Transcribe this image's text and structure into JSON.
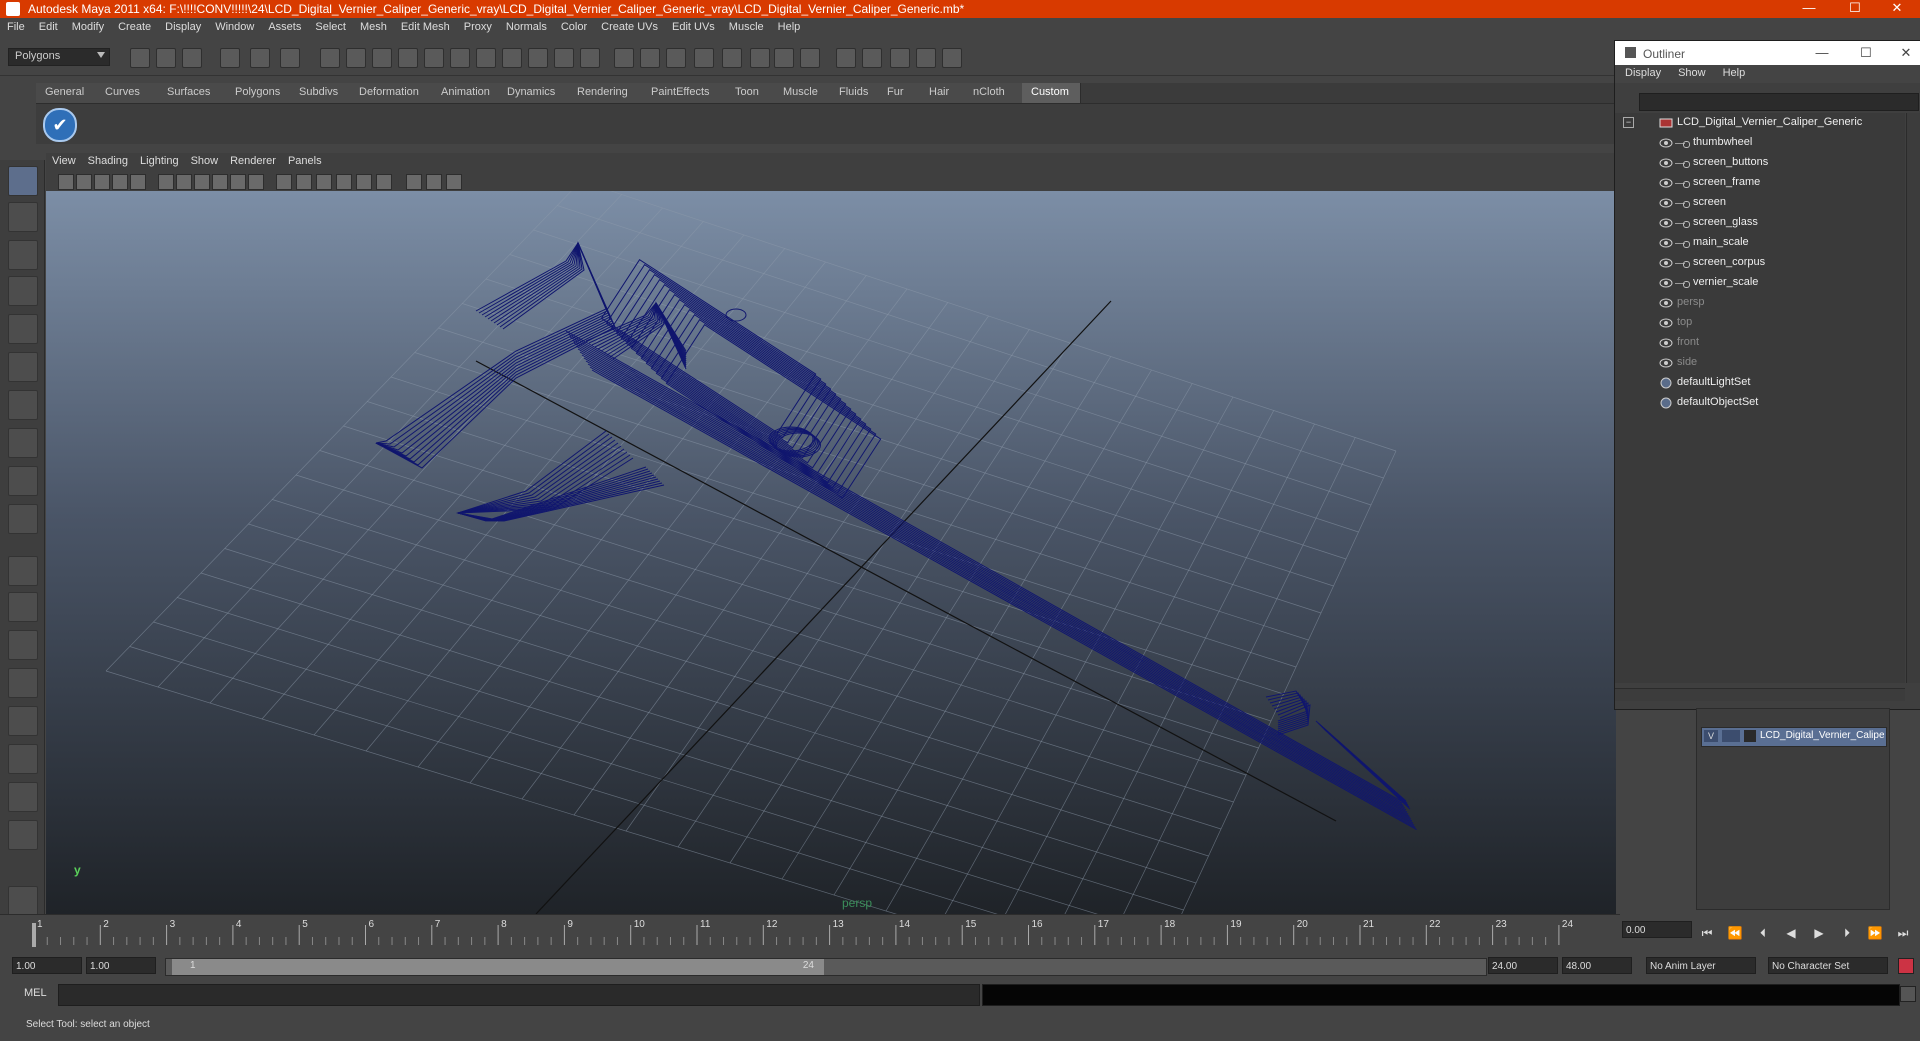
{
  "window": {
    "title": "Autodesk Maya 2011 x64: F:\\!!!!CONV!!!!!\\24\\LCD_Digital_Vernier_Caliper_Generic_vray\\LCD_Digital_Vernier_Caliper_Generic_vray\\LCD_Digital_Vernier_Caliper_Generic.mb*",
    "minimize": "—",
    "maximize": "☐",
    "close": "✕"
  },
  "menubar": [
    "File",
    "Edit",
    "Modify",
    "Create",
    "Display",
    "Window",
    "Assets",
    "Select",
    "Mesh",
    "Edit Mesh",
    "Proxy",
    "Normals",
    "Color",
    "Create UVs",
    "Edit UVs",
    "Muscle",
    "Help"
  ],
  "mode_selector": "Polygons",
  "shelf_tabs": [
    "General",
    "Curves",
    "Surfaces",
    "Polygons",
    "Subdivs",
    "Deformation",
    "Animation",
    "Dynamics",
    "Rendering",
    "PaintEffects",
    "Toon",
    "Muscle",
    "Fluids",
    "Fur",
    "Hair",
    "nCloth",
    "Custom"
  ],
  "active_shelf_tab": "Custom",
  "panel_menu": [
    "View",
    "Shading",
    "Lighting",
    "Show",
    "Renderer",
    "Panels"
  ],
  "viewport": {
    "camera_label": "persp",
    "axis_label": "y",
    "wire_color": "#10166e"
  },
  "outliner": {
    "title": "Outliner",
    "menu": [
      "Display",
      "Show",
      "Help"
    ],
    "items": [
      {
        "label": "LCD_Digital_Vernier_Caliper_Generic",
        "level": 0,
        "dim": false,
        "icon": "group-icon"
      },
      {
        "label": "thumbwheel",
        "level": 1,
        "dim": false,
        "icon": "mesh-icon"
      },
      {
        "label": "screen_buttons",
        "level": 1,
        "dim": false,
        "icon": "mesh-icon"
      },
      {
        "label": "screen_frame",
        "level": 1,
        "dim": false,
        "icon": "mesh-icon"
      },
      {
        "label": "screen",
        "level": 1,
        "dim": false,
        "icon": "mesh-icon"
      },
      {
        "label": "screen_glass",
        "level": 1,
        "dim": false,
        "icon": "mesh-icon"
      },
      {
        "label": "main_scale",
        "level": 1,
        "dim": false,
        "icon": "mesh-icon"
      },
      {
        "label": "screen_corpus",
        "level": 1,
        "dim": false,
        "icon": "mesh-icon"
      },
      {
        "label": "vernier_scale",
        "level": 1,
        "dim": false,
        "icon": "mesh-icon"
      },
      {
        "label": "persp",
        "level": 0,
        "dim": true,
        "icon": "camera-icon"
      },
      {
        "label": "top",
        "level": 0,
        "dim": true,
        "icon": "camera-icon"
      },
      {
        "label": "front",
        "level": 0,
        "dim": true,
        "icon": "camera-icon"
      },
      {
        "label": "side",
        "level": 0,
        "dim": true,
        "icon": "camera-icon"
      },
      {
        "label": "defaultLightSet",
        "level": 0,
        "dim": false,
        "icon": "set-icon"
      },
      {
        "label": "defaultObjectSet",
        "level": 0,
        "dim": false,
        "icon": "set-icon"
      }
    ]
  },
  "layers": {
    "row_visible": "V",
    "row_name": "LCD_Digital_Vernier_Caliper_Generic"
  },
  "timeline": {
    "ticks": [
      "1",
      "2",
      "3",
      "4",
      "5",
      "6",
      "7",
      "8",
      "9",
      "10",
      "11",
      "12",
      "13",
      "14",
      "15",
      "16",
      "17",
      "18",
      "19",
      "20",
      "21",
      "22",
      "23",
      "24"
    ],
    "current_time": "0.00"
  },
  "playback": [
    "⏮",
    "⏪",
    "⏴",
    "◀",
    "▶",
    "⏵",
    "⏩",
    "⏭"
  ],
  "range": {
    "start": "1.00",
    "playback_start": "1.00",
    "slider_start": "1",
    "slider_end": "24",
    "playback_end": "24.00",
    "end": "48.00",
    "anim_layer": "No Anim Layer",
    "character_set": "No Character Set"
  },
  "command_line": {
    "label": "MEL"
  },
  "help_line": "Select Tool: select an object"
}
